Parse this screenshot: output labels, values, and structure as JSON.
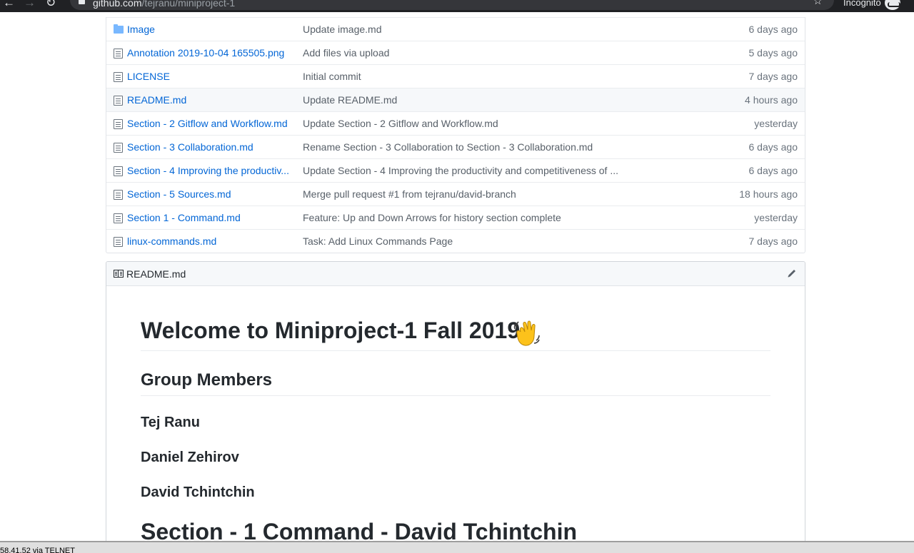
{
  "browser": {
    "back": "←",
    "forward": "→",
    "reload": "↻",
    "url_host": "github.com",
    "url_path": "/tejranu/miniproject-1",
    "star": "☆",
    "incognito_label": "Incognito"
  },
  "files": [
    {
      "name": "Image",
      "icon": "folder-icon",
      "message": "Update image.md",
      "age": "6 days ago"
    },
    {
      "name": "Annotation 2019-10-04 165505.png",
      "icon": "file-icon",
      "message": "Add files via upload",
      "age": "5 days ago"
    },
    {
      "name": "LICENSE",
      "icon": "file-icon",
      "message": "Initial commit",
      "age": "7 days ago"
    },
    {
      "name": "README.md",
      "icon": "file-icon",
      "message": "Update README.md",
      "age": "4 hours ago"
    },
    {
      "name": "Section - 2 Gitflow and Workflow.md",
      "icon": "file-icon",
      "message": "Update Section - 2 Gitflow and Workflow.md",
      "age": "yesterday"
    },
    {
      "name": "Section - 3 Collaboration.md",
      "icon": "file-icon",
      "message": "Rename Section - 3 Collaboration to Section - 3 Collaboration.md",
      "age": "6 days ago"
    },
    {
      "name": "Section - 4 Improving the productiv...",
      "icon": "file-icon",
      "message": "Update Section - 4 Improving the productivity and competitiveness of ...",
      "age": "6 days ago"
    },
    {
      "name": "Section - 5 Sources.md",
      "icon": "file-icon",
      "message": "Merge pull request #1 from tejranu/david-branch",
      "age": "18 hours ago"
    },
    {
      "name": "Section 1 - Command.md",
      "icon": "file-icon",
      "message": "Feature: Up and Down Arrows for history section complete",
      "age": "yesterday"
    },
    {
      "name": "linux-commands.md",
      "icon": "file-icon",
      "message": "Task: Add Linux Commands Page",
      "age": "7 days ago"
    }
  ],
  "readme": {
    "title": "README.md",
    "icon": "book-icon",
    "edit_icon": "pencil-icon",
    "h1": "Welcome to Miniproject-1 Fall 2019",
    "h1_emoji": "waving-hand",
    "group_heading": "Group Members",
    "members": [
      "Tej Ranu",
      "Daniel Zehirov",
      "David Tchintchin"
    ],
    "section_heading": "Section - 1 Command - David Tchintchin"
  },
  "status_bar": {
    "text": "58.41.52 via TELNET"
  },
  "colors": {
    "link": "#0366d6",
    "muted": "#586069",
    "header_bg": "#f6f8fa",
    "browser_bar": "#202124"
  }
}
